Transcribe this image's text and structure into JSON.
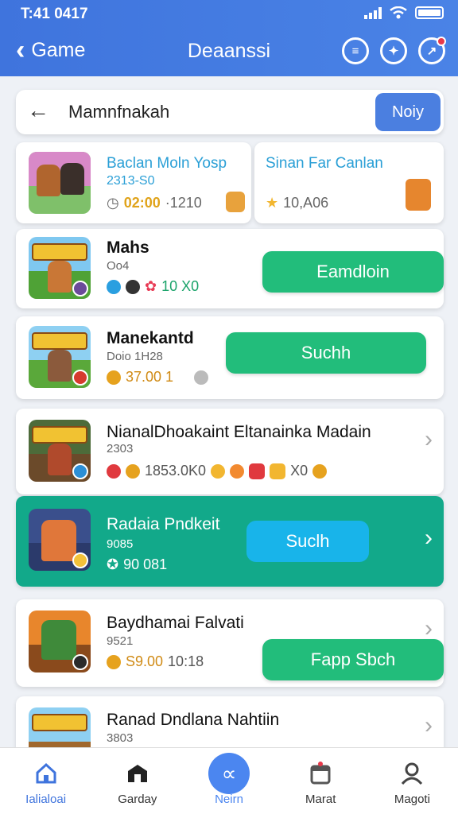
{
  "status_bar": {
    "time": "T:41 0417"
  },
  "header": {
    "back_label": "Game",
    "title": "Deaanssi"
  },
  "search": {
    "value": "Mamnfnakah",
    "button_label": "Noiy"
  },
  "featured": [
    {
      "title": "Baclan Moln Yosp",
      "subtitle": "2313-S0",
      "meta": "02:00",
      "meta2": "·1210"
    },
    {
      "title": "Sinan Far Canlan",
      "meta": "10,A06"
    }
  ],
  "rows": [
    {
      "title": "Mahs",
      "sub": "Oo4",
      "stat": "10 X0",
      "button": "Eamdloin"
    },
    {
      "title": "Manekantd",
      "sub": "Doio 1H28",
      "stat": "37.00 1",
      "button": "Suchh"
    },
    {
      "title": "NianalDhoakaint Eltanainka Madain",
      "sub": "2303",
      "stat": "1853.0K0",
      "stat2": "X0"
    },
    {
      "title": "Radaia Pndkeit",
      "sub": "9085",
      "stat": "90 081",
      "button": "Suclh"
    },
    {
      "title": "Baydhamai Falvati",
      "sub": "9521",
      "stat": "S9.00",
      "stat2": "10:18",
      "button": "Fapp Sbch"
    },
    {
      "title": "Ranad Dndlana Nahtiin",
      "sub": "3803"
    }
  ],
  "nav": [
    {
      "label": "Ialialoai",
      "icon": "home-icon"
    },
    {
      "label": "Garday",
      "icon": "shop-icon"
    },
    {
      "label": "Neirn",
      "icon": "search-icon"
    },
    {
      "label": "Marat",
      "icon": "calendar-icon"
    },
    {
      "label": "Magoti",
      "icon": "profile-icon"
    }
  ],
  "colors": {
    "header": "#3f74dd",
    "accent_green": "#22bd7b",
    "accent_teal": "#12a98a",
    "accent_blue": "#18b4ea"
  }
}
